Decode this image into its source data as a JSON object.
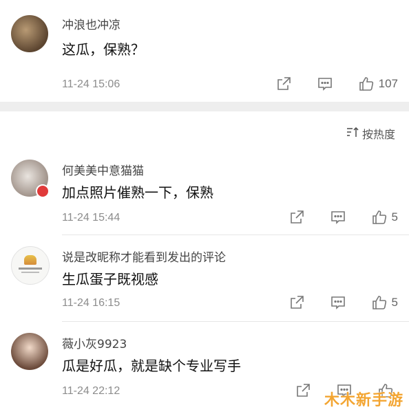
{
  "comments_top": {
    "username": "冲浪也冲凉",
    "content": "这瓜，保熟？",
    "time": "11-24 15:06",
    "like_count": "107"
  },
  "sort": {
    "label": "按热度",
    "icon": "sort-icon"
  },
  "comments": [
    {
      "username": "何美美中意猫猫",
      "content": "加点照片催熟一下，保熟",
      "time": "11-24 15:44",
      "like_count": "5"
    },
    {
      "username": "说是改昵称才能看到发出的评论",
      "content": "生瓜蛋子既视感",
      "time": "11-24 16:15",
      "like_count": "5"
    },
    {
      "username": "薇小灰9923",
      "content": "瓜是好瓜，就是缺个专业写手",
      "time": "11-24 22:12",
      "like_count": ""
    }
  ],
  "watermark": "木木新手游",
  "colors": {
    "accent_red": "#e03a3a",
    "muted": "#8c8c8c",
    "watermark": "#f3a532"
  }
}
